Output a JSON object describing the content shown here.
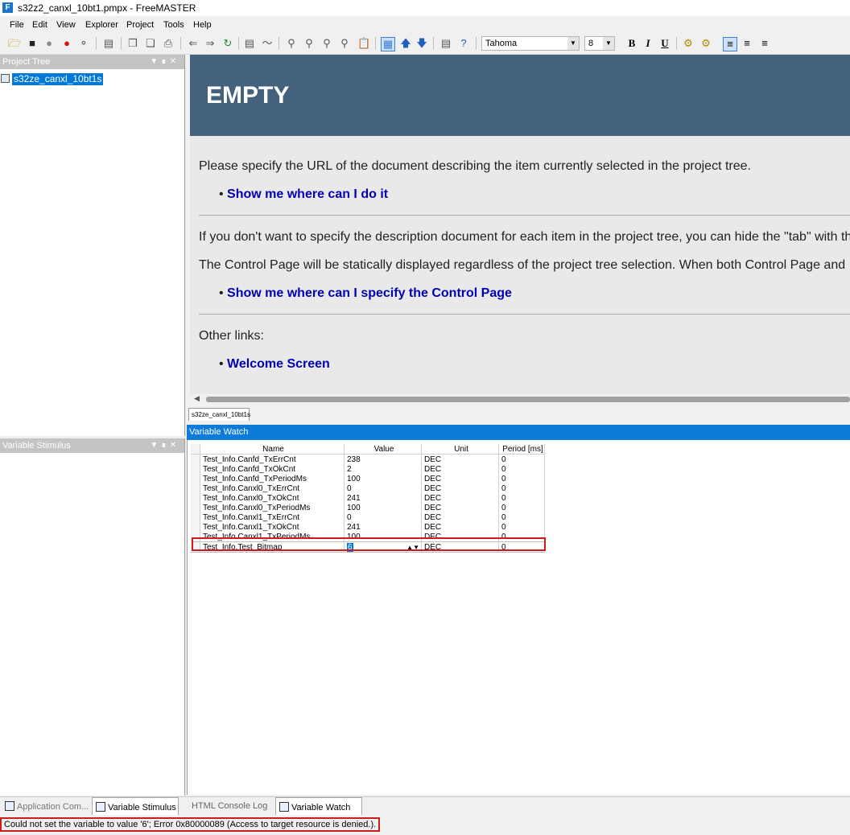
{
  "window": {
    "title": "s32z2_canxl_10bt1.pmpx - FreeMASTER",
    "app_icon_letter": "F"
  },
  "menu": [
    "File",
    "Edit",
    "View",
    "Explorer",
    "Project",
    "Tools",
    "Help"
  ],
  "toolbar": {
    "font_name": "Tahoma",
    "font_size": "8",
    "bold": "B",
    "italic": "I",
    "underline": "U"
  },
  "project_tree": {
    "title": "Project Tree",
    "selected_item": "s32ze_canxl_10bt1s"
  },
  "variable_stimulus": {
    "title": "Variable Stimulus"
  },
  "html_page": {
    "heading": "EMPTY",
    "para1": "Please specify the URL of the document describing the item currently selected in the project tree.",
    "link1": "Show me where can I do it",
    "para2": "If you don't want to specify the description document for each item in the project tree, you can hide the \"tab\" with th",
    "para3": "The Control Page will be statically displayed regardless of the project tree selection. When both Control Page and",
    "link2": "Show me where can I specify the Control Page",
    "para4": "Other links:",
    "link3": "Welcome Screen"
  },
  "doc_tab": "s32ze_canxl_10bt1s",
  "variable_watch": {
    "title": "Variable Watch",
    "columns": [
      "Name",
      "Value",
      "Unit",
      "Period [ms]"
    ],
    "rows": [
      [
        "Test_Info.Canfd_TxErrCnt",
        "238",
        "DEC",
        "0"
      ],
      [
        "Test_Info.Canfd_TxOkCnt",
        "2",
        "DEC",
        "0"
      ],
      [
        "Test_Info.Canfd_TxPeriodMs",
        "100",
        "DEC",
        "0"
      ],
      [
        "Test_Info.Canxl0_TxErrCnt",
        "0",
        "DEC",
        "0"
      ],
      [
        "Test_Info.Canxl0_TxOkCnt",
        "241",
        "DEC",
        "0"
      ],
      [
        "Test_Info.Canxl0_TxPeriodMs",
        "100",
        "DEC",
        "0"
      ],
      [
        "Test_Info.Canxl1_TxErrCnt",
        "0",
        "DEC",
        "0"
      ],
      [
        "Test_Info.Canxl1_TxOkCnt",
        "241",
        "DEC",
        "0"
      ],
      [
        "Test_Info.Canxl1_TxPeriodMs",
        "100",
        "DEC",
        "0"
      ]
    ],
    "editing_row": {
      "name": "Test_Info.Test_Bitmap",
      "value": "6",
      "unit": "DEC",
      "period": "0"
    }
  },
  "bottom_tabs": [
    "Application Com...",
    "Variable Stimulus",
    "HTML Console Log",
    "Variable Watch"
  ],
  "status": {
    "message": "Could not set the variable to value '6'; Error 0x80000089 (Access to target resource is denied.)."
  },
  "colors": {
    "html_header": "#44617d",
    "link": "#0000b3",
    "watch_header": "#0e7bd8",
    "selection": "#0078d7",
    "error_outline": "#d11b1b"
  }
}
